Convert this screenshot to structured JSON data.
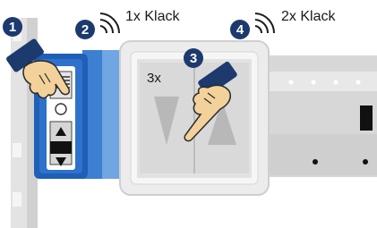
{
  "steps": [
    {
      "number": "1"
    },
    {
      "number": "2",
      "label": "1x Klack"
    },
    {
      "number": "3",
      "label": "3x"
    },
    {
      "number": "4",
      "label": "2x Klack"
    }
  ],
  "colors": {
    "badge": "#1c3a6e",
    "module_blue": "#2f6fc4",
    "switch_frame": "#e8e8e8",
    "rail": "#d6d6d6",
    "hand_skin": "#f3d19a",
    "sleeve": "#1c3a6e"
  },
  "icons": [
    "sound-waves-icon",
    "pointing-hand-icon"
  ]
}
